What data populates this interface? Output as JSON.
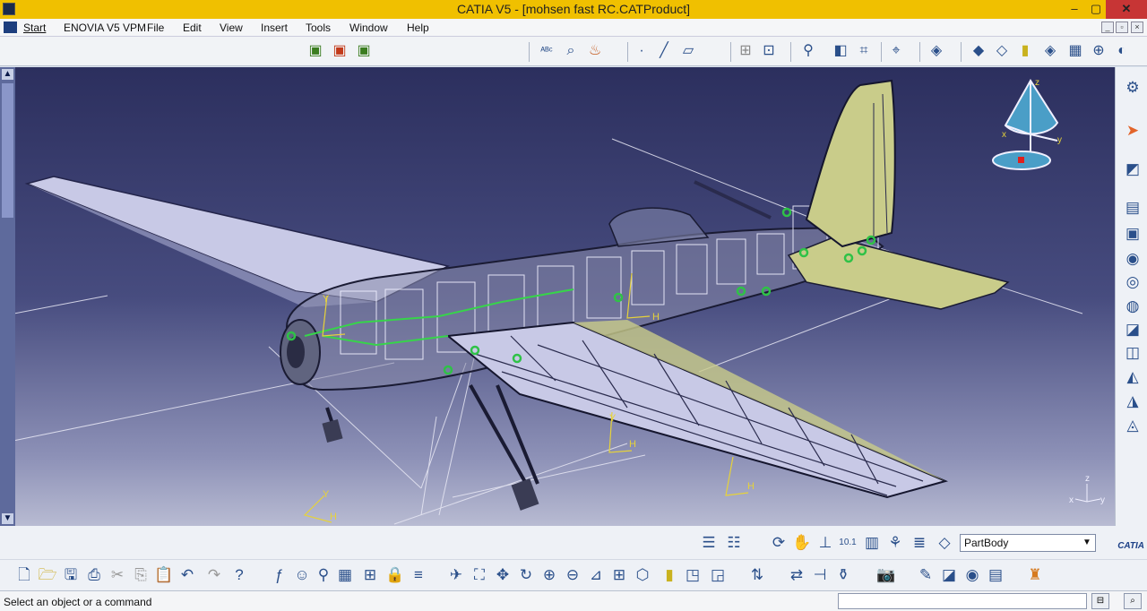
{
  "window": {
    "title": "CATIA V5 - [mohsen fast RC.CATProduct]",
    "minimize": "–",
    "maximize": "▢",
    "close": "✕"
  },
  "menu": {
    "items": [
      "Start",
      "ENOVIA V5 VPM",
      "File",
      "Edit",
      "View",
      "Insert",
      "Tools",
      "Window",
      "Help"
    ]
  },
  "bottom_toolbar": {
    "selector_value": "PartBody",
    "logo_text": "CATIA"
  },
  "status": {
    "message": "Select an object or a command"
  },
  "compass": {
    "labels": [
      "z",
      "x",
      "y"
    ]
  },
  "axis_triad": {
    "labels": [
      "z",
      "x",
      "y"
    ]
  },
  "viewport_labels": [
    "H",
    "H",
    "H",
    "H",
    "Y",
    "Y",
    "Y"
  ],
  "colors": {
    "titlebar": "#f0c000",
    "viewport_top": "#2c2f5e",
    "viewport_bottom": "#b8bbd2",
    "wing_surface": "#c8c9e6",
    "tail_surface": "#c9cc8a",
    "wire_green": "#37d44a",
    "wire_yellow": "#e6d23a"
  }
}
